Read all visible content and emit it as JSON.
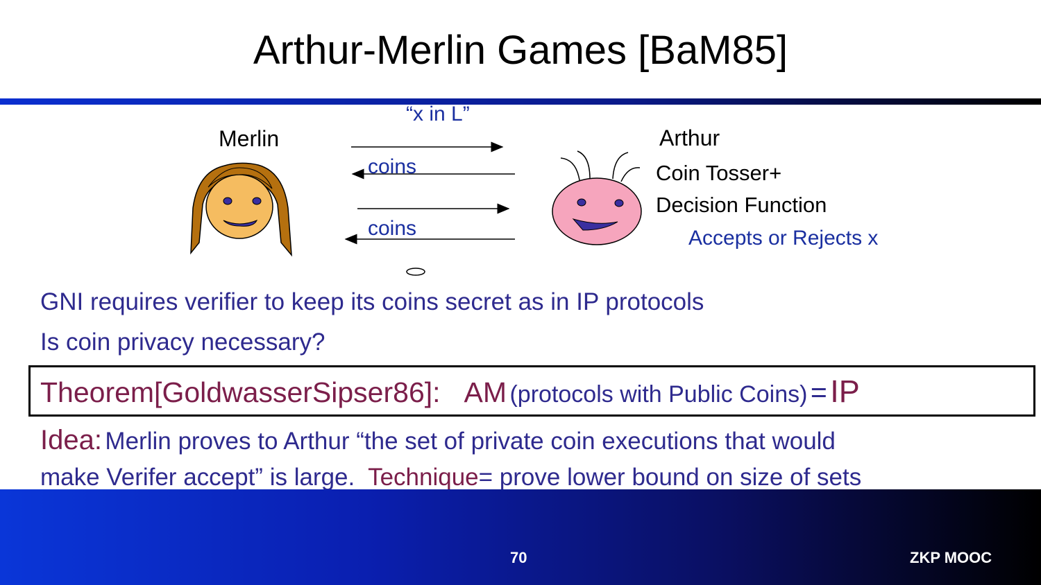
{
  "slide": {
    "title": "Arthur-Merlin Games [BaM85]",
    "diagram": {
      "message_x_in_l": "“x in L”",
      "merlin_label": "Merlin",
      "arthur_label": "Arthur",
      "coins_1": "coins",
      "coins_2": "coins",
      "coin_tosser": "Coin Tosser+",
      "decision_function": "Decision Function",
      "accepts_rejects": "Accepts or Rejects x"
    },
    "line_gni": "GNI requires verifier to keep its coins secret as in IP protocols",
    "line_privacy": "Is coin privacy necessary?",
    "theorem": {
      "label": "Theorem[GoldwasserSipser86]:",
      "am": "AM",
      "paren": "(protocols with Public Coins)",
      "eq": "=",
      "ip": "IP"
    },
    "idea": {
      "label": "Idea:",
      "text1": "Merlin proves to Arthur  “the set of private coin executions that would",
      "text2a": "make Verifer accept” is large.  ",
      "technique": "Technique",
      "text2b": "= prove lower bound on size of sets"
    },
    "footer": {
      "page_number": "70",
      "course": "ZKP MOOC"
    },
    "colors": {
      "title": "#000000",
      "body_blue": "#2e2a8e",
      "maroon": "#7b1e4a",
      "footer_start": "#0a36d8",
      "footer_end": "#000000"
    }
  }
}
